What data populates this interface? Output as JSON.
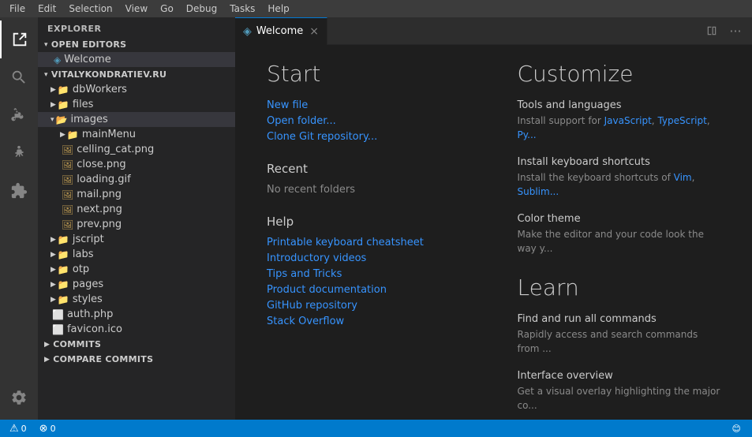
{
  "menubar": {
    "items": [
      "File",
      "Edit",
      "Selection",
      "View",
      "Go",
      "Debug",
      "Tasks",
      "Help"
    ]
  },
  "activity_bar": {
    "icons": [
      {
        "name": "explorer-icon",
        "symbol": "⬜",
        "label": "Explorer",
        "active": true
      },
      {
        "name": "search-icon",
        "symbol": "🔍",
        "label": "Search"
      },
      {
        "name": "source-control-icon",
        "symbol": "⑂",
        "label": "Source Control"
      },
      {
        "name": "debug-icon",
        "symbol": "🐛",
        "label": "Debug"
      },
      {
        "name": "extensions-icon",
        "symbol": "⊞",
        "label": "Extensions"
      }
    ],
    "bottom_icons": [
      {
        "name": "settings-icon",
        "symbol": "⚙",
        "label": "Settings"
      }
    ]
  },
  "sidebar": {
    "title": "Explorer",
    "sections": {
      "open_editors": {
        "label": "Open Editors",
        "items": [
          {
            "name": "Welcome",
            "icon": "vscode",
            "active": true
          }
        ]
      },
      "project": {
        "label": "VITALYKONDRATIEV.RU",
        "items": [
          {
            "name": "dbWorkers",
            "type": "folder",
            "indent": 1
          },
          {
            "name": "files",
            "type": "folder",
            "indent": 1
          },
          {
            "name": "images",
            "type": "folder",
            "indent": 1,
            "open": true
          },
          {
            "name": "mainMenu",
            "type": "folder",
            "indent": 2
          },
          {
            "name": "celling_cat.png",
            "type": "image",
            "indent": 2
          },
          {
            "name": "close.png",
            "type": "image",
            "indent": 2
          },
          {
            "name": "loading.gif",
            "type": "image",
            "indent": 2
          },
          {
            "name": "mail.png",
            "type": "image",
            "indent": 2
          },
          {
            "name": "next.png",
            "type": "image",
            "indent": 2
          },
          {
            "name": "prev.png",
            "type": "image",
            "indent": 2
          },
          {
            "name": "jscript",
            "type": "folder",
            "indent": 1
          },
          {
            "name": "labs",
            "type": "folder",
            "indent": 1
          },
          {
            "name": "otp",
            "type": "folder",
            "indent": 1
          },
          {
            "name": "pages",
            "type": "folder",
            "indent": 1
          },
          {
            "name": "styles",
            "type": "folder",
            "indent": 1
          },
          {
            "name": "auth.php",
            "type": "php",
            "indent": 1
          },
          {
            "name": "favicon.ico",
            "type": "ico",
            "indent": 1
          }
        ]
      },
      "commits": {
        "label": "Commits"
      },
      "compare_commits": {
        "label": "Compare Commits"
      }
    }
  },
  "tabs": [
    {
      "label": "Welcome",
      "icon": "vscode-icon",
      "active": true,
      "closeable": true
    }
  ],
  "welcome": {
    "start_heading": "Start",
    "new_file_link": "New file",
    "open_folder_link": "Open folder...",
    "clone_git_link": "Clone Git repository...",
    "recent_heading": "Recent",
    "no_recent": "No recent folders",
    "help_heading": "Help",
    "help_links": [
      "Printable keyboard cheatsheet",
      "Introductory videos",
      "Tips and Tricks",
      "Product documentation",
      "GitHub repository",
      "Stack Overflow"
    ],
    "customize_heading": "Customize",
    "customize_items": [
      {
        "title": "Tools and languages",
        "desc_prefix": "Install support for ",
        "links": [
          "JavaScript",
          "TypeScript",
          "Py..."
        ],
        "desc_suffix": ""
      },
      {
        "title": "Install keyboard shortcuts",
        "desc_prefix": "Install the keyboard shortcuts of ",
        "links": [
          "Vim",
          "Sublim..."
        ],
        "desc_suffix": ""
      },
      {
        "title": "Color theme",
        "desc_prefix": "Make the editor and your code look the way y...",
        "links": [],
        "desc_suffix": ""
      }
    ],
    "learn_heading": "Learn",
    "learn_items": [
      {
        "title": "Find and run all commands",
        "desc": "Rapidly access and search commands from ..."
      },
      {
        "title": "Interface overview",
        "desc": "Get a visual overlay highlighting the major co..."
      }
    ]
  },
  "status_bar": {
    "left": [
      {
        "icon": "⚠",
        "text": "0"
      },
      {
        "icon": "⊗",
        "text": "0"
      }
    ],
    "right": [
      {
        "text": "😊"
      }
    ]
  }
}
